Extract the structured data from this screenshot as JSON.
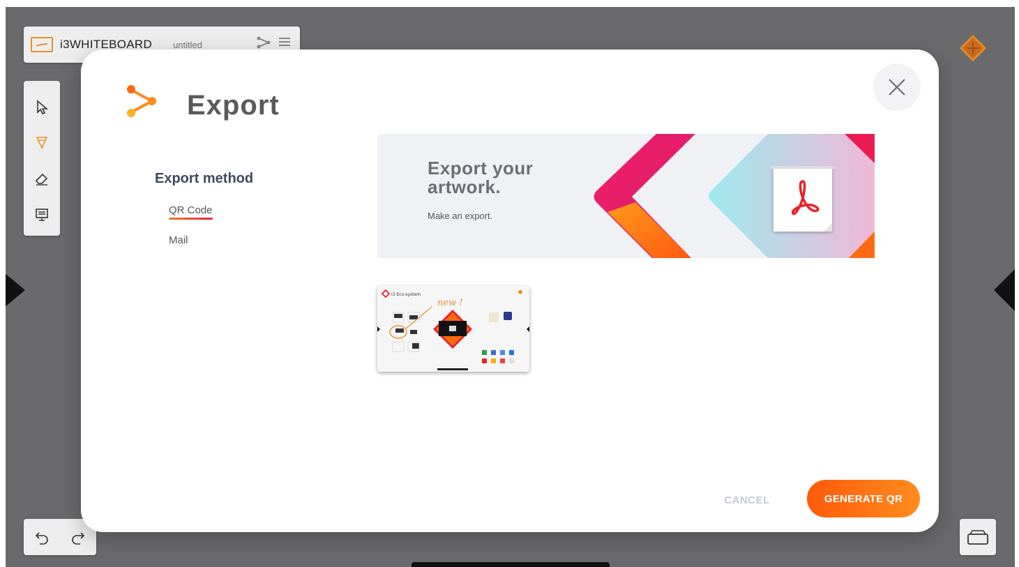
{
  "app": {
    "title": "i3WHITEBOARD",
    "document_name": "untitled"
  },
  "modal": {
    "title": "Export",
    "export_method_heading": "Export method",
    "methods": [
      {
        "label": "QR Code",
        "active": true
      },
      {
        "label": "Mail",
        "active": false
      }
    ],
    "banner": {
      "title": "Export your artwork.",
      "subtitle": "Make an export."
    },
    "thumbnail": {
      "heading": "i3 Eco-system",
      "annotation": "new !"
    },
    "cancel_label": "CANCEL",
    "generate_label": "GENERATE QR"
  },
  "colors": {
    "accent_orange": "#ff6a10",
    "accent_pink": "#e8233d",
    "title_gray": "#5a5a5a",
    "heading_navy": "#3e4a5c",
    "pdf_red": "#e8232a"
  },
  "icons": {
    "export": "share-nodes-icon",
    "close": "close-x-icon",
    "pdf": "acrobat-pdf-icon"
  }
}
